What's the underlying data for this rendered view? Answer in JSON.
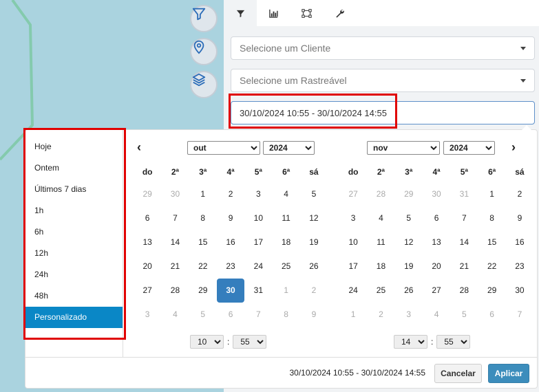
{
  "map": {
    "buttons": [
      {
        "name": "filter-map-button",
        "icon": "filter-icon"
      },
      {
        "name": "location-map-button",
        "icon": "map-pin-icon"
      },
      {
        "name": "layers-map-button",
        "icon": "layers-icon"
      }
    ]
  },
  "panel": {
    "tabs": [
      {
        "icon": "filter-icon",
        "active": true
      },
      {
        "icon": "bar-chart-icon",
        "active": false
      },
      {
        "icon": "network-icon",
        "active": false
      },
      {
        "icon": "wrench-icon",
        "active": false
      }
    ],
    "client_select": {
      "placeholder": "Selecione um Cliente"
    },
    "tracker_select": {
      "placeholder": "Selecione um Rastreável"
    },
    "date_range_value": "30/10/2024 10:55 - 30/10/2024 14:55"
  },
  "picker": {
    "ranges": [
      "Hoje",
      "Ontem",
      "Últimos 7 dias",
      "1h",
      "6h",
      "12h",
      "24h",
      "48h",
      "Personalizado"
    ],
    "active_range": "Personalizado",
    "weekdays": [
      "do",
      "2ª",
      "3ª",
      "4ª",
      "5ª",
      "6ª",
      "sá"
    ],
    "left": {
      "month": "out",
      "year": "2024",
      "days": [
        [
          29,
          1
        ],
        [
          30,
          1
        ],
        [
          1,
          0
        ],
        [
          2,
          0
        ],
        [
          3,
          0
        ],
        [
          4,
          0
        ],
        [
          5,
          0
        ],
        [
          6,
          0
        ],
        [
          7,
          0
        ],
        [
          8,
          0
        ],
        [
          9,
          0
        ],
        [
          10,
          0
        ],
        [
          11,
          0
        ],
        [
          12,
          0
        ],
        [
          13,
          0
        ],
        [
          14,
          0
        ],
        [
          15,
          0
        ],
        [
          16,
          0
        ],
        [
          17,
          0
        ],
        [
          18,
          0
        ],
        [
          19,
          0
        ],
        [
          20,
          0
        ],
        [
          21,
          0
        ],
        [
          22,
          0
        ],
        [
          23,
          0
        ],
        [
          24,
          0
        ],
        [
          25,
          0
        ],
        [
          26,
          0
        ],
        [
          27,
          0
        ],
        [
          28,
          0
        ],
        [
          29,
          0
        ],
        [
          30,
          2
        ],
        [
          31,
          0
        ],
        [
          1,
          1
        ],
        [
          2,
          1
        ],
        [
          3,
          1
        ],
        [
          4,
          1
        ],
        [
          5,
          1
        ],
        [
          6,
          1
        ],
        [
          7,
          1
        ],
        [
          8,
          1
        ],
        [
          9,
          1
        ]
      ],
      "hour": "10",
      "minute": "55"
    },
    "right": {
      "month": "nov",
      "year": "2024",
      "days": [
        [
          27,
          1
        ],
        [
          28,
          1
        ],
        [
          29,
          1
        ],
        [
          30,
          1
        ],
        [
          31,
          1
        ],
        [
          1,
          0
        ],
        [
          2,
          0
        ],
        [
          3,
          0
        ],
        [
          4,
          0
        ],
        [
          5,
          0
        ],
        [
          6,
          0
        ],
        [
          7,
          0
        ],
        [
          8,
          0
        ],
        [
          9,
          0
        ],
        [
          10,
          0
        ],
        [
          11,
          0
        ],
        [
          12,
          0
        ],
        [
          13,
          0
        ],
        [
          14,
          0
        ],
        [
          15,
          0
        ],
        [
          16,
          0
        ],
        [
          17,
          0
        ],
        [
          18,
          0
        ],
        [
          19,
          0
        ],
        [
          20,
          0
        ],
        [
          21,
          0
        ],
        [
          22,
          0
        ],
        [
          23,
          0
        ],
        [
          24,
          0
        ],
        [
          25,
          0
        ],
        [
          26,
          0
        ],
        [
          27,
          0
        ],
        [
          28,
          0
        ],
        [
          29,
          0
        ],
        [
          30,
          0
        ],
        [
          1,
          1
        ],
        [
          2,
          1
        ],
        [
          3,
          1
        ],
        [
          4,
          1
        ],
        [
          5,
          1
        ],
        [
          6,
          1
        ],
        [
          7,
          1
        ]
      ],
      "hour": "14",
      "minute": "55"
    },
    "selected_text": "30/10/2024 10:55 - 30/10/2024 14:55",
    "cancel_label": "Cancelar",
    "apply_label": "Aplicar"
  },
  "colors": {
    "map_water": "#aad3df",
    "route_line": "#7ec8a4",
    "highlight": "#e00000",
    "active_range": "#0a87c6",
    "apply_button": "#3c8dbc",
    "selected_day": "#357ebd"
  }
}
